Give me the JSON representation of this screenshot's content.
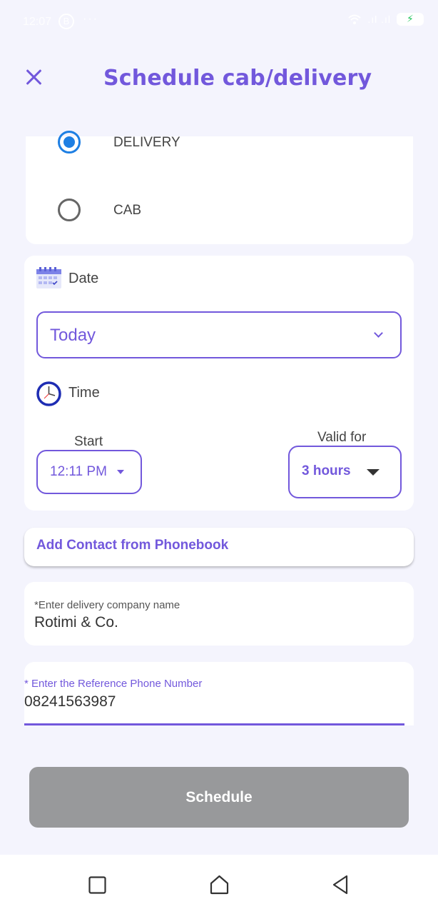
{
  "status_bar": {
    "time": "12:07",
    "b_badge": "B",
    "dots": "···",
    "signal": ".ıl .ıl",
    "battery_bolt": "⚡"
  },
  "header": {
    "title": "Schedule cab/delivery"
  },
  "type_options": [
    {
      "label": "DELIVERY",
      "selected": true
    },
    {
      "label": "CAB",
      "selected": false
    }
  ],
  "date": {
    "label": "Date",
    "value": "Today"
  },
  "time": {
    "label": "Time",
    "start_label": "Start",
    "start_value": "12:11 PM",
    "valid_label": "Valid for",
    "valid_value": "3 hours"
  },
  "contact_button": {
    "label": "Add Contact from Phonebook"
  },
  "company_field": {
    "label": "*Enter delivery company name",
    "value": "Rotimi & Co."
  },
  "phone_field": {
    "label": "* Enter the Reference Phone Number",
    "value": "08241563987"
  },
  "schedule_button": {
    "label": "Schedule"
  },
  "colors": {
    "accent": "#7258dc",
    "radio_selected": "#1e7fe3",
    "background": "#f4f4fd",
    "disabled_button": "#98999b"
  }
}
